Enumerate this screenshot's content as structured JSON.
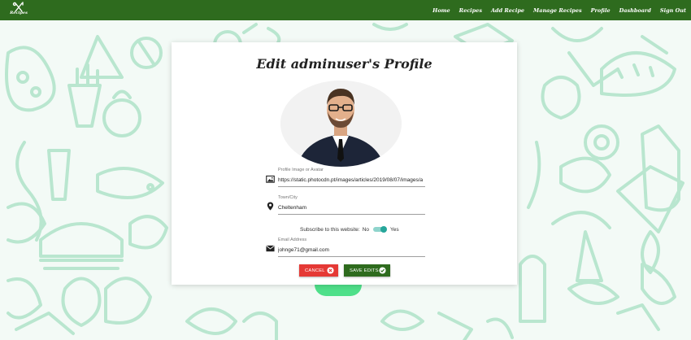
{
  "navbar": {
    "logo_text": "Recipes",
    "links": [
      "Home",
      "Recipes",
      "Add Recipe",
      "Manage Recipes",
      "Profile",
      "Dashboard",
      "Sign Out"
    ]
  },
  "form": {
    "title": "Edit adminuser's Profile",
    "image_label": "Profile Image or Avatar",
    "image_value": "https://static.photocdn.pt/images/articles/2019/08/07/images/a",
    "city_label": "Town/City",
    "city_value": "Cheltenham",
    "subscribe_text": "Subscribe to this website:",
    "subscribe_no": "No",
    "subscribe_yes": "Yes",
    "subscribe_checked": true,
    "email_label": "Email Address",
    "email_value": "johnge71@gmail.com",
    "cancel_label": "CANCEL",
    "save_label": "SAVE EDITS"
  },
  "colors": {
    "navbar": "#2e6b1e",
    "cancel": "#e53935",
    "save": "#2e6b1e",
    "toggle": "#26a69a",
    "doodle": "#b9e6cf"
  },
  "icons": {
    "cancel": "close-circle-icon",
    "save": "check-circle-icon",
    "image": "image-icon",
    "city": "location-pin-icon",
    "email": "envelope-icon"
  }
}
